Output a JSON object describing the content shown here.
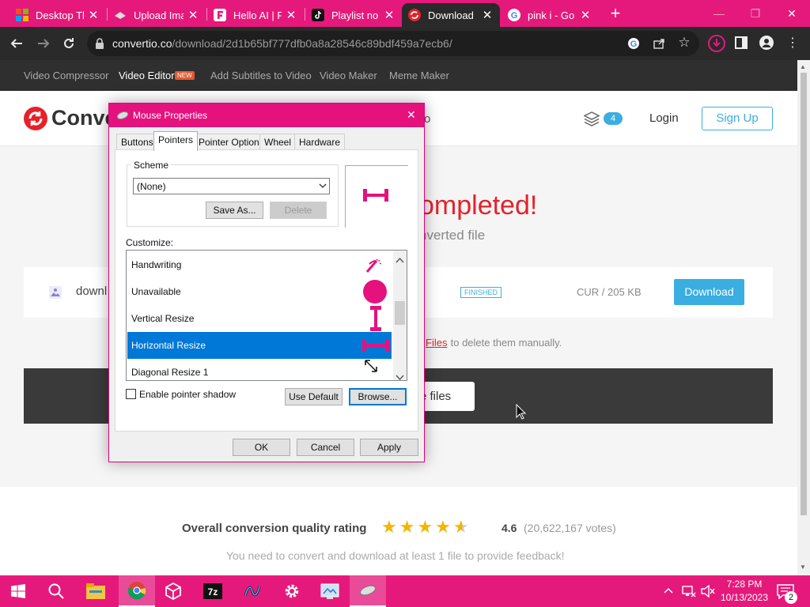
{
  "browser": {
    "tabs": [
      {
        "title": "Desktop Th",
        "icon": "windows-logo-icon"
      },
      {
        "title": "Upload Ima",
        "icon": "upload-icon"
      },
      {
        "title": "Hello AI | F",
        "icon": "f-logo-icon"
      },
      {
        "title": "Playlist no",
        "icon": "tiktok-icon"
      },
      {
        "title": "Download",
        "icon": "convertio-icon",
        "active": true
      },
      {
        "title": "pink i - Go",
        "icon": "google-icon"
      }
    ],
    "new_tab": "+",
    "url_host": "convertio.co",
    "url_path": "/download/2d1b65bf777dfb0a8a28546c89bdf459a7ecb6/"
  },
  "site": {
    "nav": [
      "Video Compressor",
      "Video Editor",
      "Add Subtitles to Video",
      "Video Maker",
      "Meme Maker"
    ],
    "new_badge": "NEW",
    "logo_text": "Conve",
    "header_partial": "o",
    "stack_count": "4",
    "login": "Login",
    "signup": "Sign Up",
    "completed": "ompleted!",
    "subtitle": "nverted file",
    "file_name": "downl",
    "status": "FINISHED",
    "file_info": "CUR / 205 KB",
    "download_btn": "Download",
    "delete_link": "Files",
    "delete_text": " to delete them manually.",
    "more_files": "re files",
    "rating_label": "Overall conversion quality rating",
    "rating_value": "4.6",
    "rating_votes": "(20,622,167 votes)",
    "rating_stars": 4.5,
    "feedback_note": "You need to convert and download at least 1 file to provide feedback!",
    "colors": {
      "accent": "#e5197b",
      "brand_red": "#e5222a",
      "download": "#3aaee0"
    }
  },
  "dialog": {
    "title": "Mouse Properties",
    "tabs": [
      "Buttons",
      "Pointers",
      "Pointer Options",
      "Wheel",
      "Hardware"
    ],
    "scheme_label": "Scheme",
    "scheme_value": "(None)",
    "save_as": "Save As...",
    "delete": "Delete",
    "customize_label": "Customize:",
    "items": [
      {
        "name": "Handwriting",
        "icon": "handwriting-cursor-icon"
      },
      {
        "name": "Unavailable",
        "icon": "unavailable-cursor-icon"
      },
      {
        "name": "Vertical Resize",
        "icon": "vertical-resize-icon"
      },
      {
        "name": "Horizontal Resize",
        "icon": "horizontal-resize-icon",
        "selected": true
      },
      {
        "name": "Diagonal Resize 1",
        "icon": "diagonal-resize-icon"
      }
    ],
    "shadow_label": "Enable pointer shadow",
    "use_default": "Use Default",
    "browse": "Browse...",
    "ok": "OK",
    "cancel": "Cancel",
    "apply": "Apply"
  },
  "taskbar": {
    "time": "7:28 PM",
    "date": "10/13/2023",
    "notifications": "2"
  }
}
